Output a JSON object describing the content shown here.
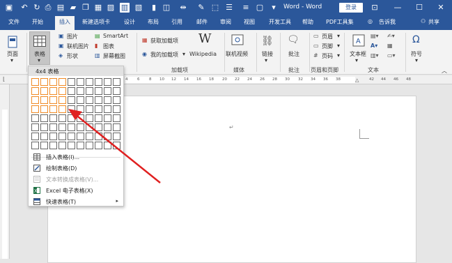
{
  "titlebar": {
    "title": "Word - Word",
    "login": "登录"
  },
  "menubar": {
    "items": [
      "文件",
      "开始",
      "插入",
      "新建选项卡",
      "设计",
      "布局",
      "引用",
      "邮件",
      "审阅",
      "视图",
      "开发工具",
      "帮助",
      "PDF工具集"
    ],
    "tell_me": "告诉我",
    "share": "共享"
  },
  "ribbon": {
    "page": "页面",
    "table": "表格",
    "picture": "图片",
    "online_picture": "联机图片",
    "shapes": "形状",
    "smartart": "SmartArt",
    "chart": "图表",
    "screenshot": "屏幕截图",
    "get_addins": "获取加载项",
    "my_addins": "我的加载项",
    "wikipedia": "Wikipedia",
    "addins_group": "加载项",
    "online_video": "联机视频",
    "media_group": "媒体",
    "link": "链接",
    "comment": "批注",
    "comment_group": "批注",
    "header": "页眉",
    "footer": "页脚",
    "page_number": "页码",
    "header_footer_group": "页眉和页脚",
    "textbox": "文本框",
    "text_group": "文本",
    "symbol": "符号"
  },
  "ruler": {
    "ticks": [
      "4",
      "6",
      "8",
      "10",
      "12",
      "14",
      "16",
      "18",
      "20",
      "22",
      "24",
      "26",
      "28",
      "30",
      "32",
      "34",
      "36",
      "38",
      "42",
      "44",
      "46",
      "48"
    ]
  },
  "dropdown": {
    "header": "4x4 表格",
    "grid_cols": 10,
    "grid_rows": 8,
    "selected_cols": 4,
    "selected_rows": 4,
    "items": [
      {
        "label": "插入表格(I)...",
        "disabled": false,
        "submenu": false
      },
      {
        "label": "绘制表格(D)",
        "disabled": false,
        "submenu": false
      },
      {
        "label": "文本转换成表格(V)...",
        "disabled": true,
        "submenu": false
      },
      {
        "label": "Excel 电子表格(X)",
        "disabled": false,
        "submenu": false
      },
      {
        "label": "快速表格(T)",
        "disabled": false,
        "submenu": true
      }
    ]
  },
  "colors": {
    "brand": "#2b579a",
    "selection": "#f08a24",
    "arrow": "#e02020"
  }
}
